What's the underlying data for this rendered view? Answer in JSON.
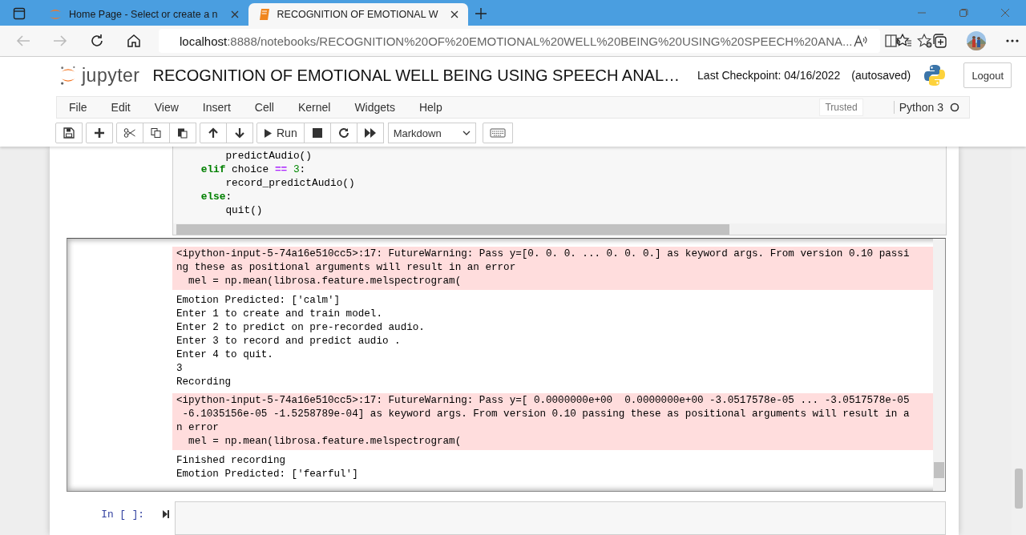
{
  "browser": {
    "tabs": [
      {
        "title": "Home Page - Select or create a n",
        "selected": false,
        "kind": "jupyter"
      },
      {
        "title": "RECOGNITION OF EMOTIONAL W",
        "selected": true,
        "kind": "notebook"
      }
    ],
    "address": {
      "host": "localhost",
      "path": ":8888/notebooks/RECOGNITION%20OF%20EMOTIONAL%20WELL%20BEING%20USING%20SPEECH%20ANA..."
    }
  },
  "notebook_header": {
    "logo": "jupyter",
    "title": "RECOGNITION OF EMOTIONAL WELL BEING USING SPEECH ANAL…",
    "checkpoint": "Last Checkpoint: 04/16/2022",
    "autosave": "(autosaved)",
    "logout": "Logout"
  },
  "menu": [
    "File",
    "Edit",
    "View",
    "Insert",
    "Cell",
    "Kernel",
    "Widgets",
    "Help"
  ],
  "trusted": "Trusted",
  "kernel": "Python 3",
  "toolbar": {
    "run": "Run",
    "cell_type": "Markdown"
  },
  "code_cell": {
    "lines": [
      [
        {
          "text": "        predictAudio()",
          "kind": "plain"
        }
      ],
      [
        {
          "text": "    elif",
          "kind": "keyword"
        },
        {
          "text": " choice ",
          "kind": "plain"
        },
        {
          "text": "==",
          "kind": "operator"
        },
        {
          "text": " 3",
          "kind": "number"
        },
        {
          "text": ":",
          "kind": "plain"
        }
      ],
      [
        {
          "text": "        record_predictAudio()",
          "kind": "plain"
        }
      ],
      [
        {
          "text": "    else",
          "kind": "keyword"
        },
        {
          "text": ":",
          "kind": "plain"
        }
      ],
      [
        {
          "text": "        quit()",
          "kind": "plain"
        }
      ]
    ]
  },
  "output": [
    {
      "kind": "stderr",
      "lines": [
        "<ipython-input-5-74a16e510cc5>:17: FutureWarning: Pass y=[0. 0. 0. ... 0. 0. 0.] as keyword args. From version 0.10 passi",
        "ng these as positional arguments will result in an error",
        "  mel = np.mean(librosa.feature.melspectrogram("
      ]
    },
    {
      "kind": "stdout",
      "lines": [
        "Emotion Predicted: ['calm']",
        "Enter 1 to create and train model.",
        "Enter 2 to predict on pre-recorded audio.",
        "Enter 3 to record and predict audio .",
        "Enter 4 to quit.",
        "3",
        "Recording"
      ]
    },
    {
      "kind": "stderr",
      "lines": [
        "<ipython-input-5-74a16e510cc5>:17: FutureWarning: Pass y=[ 0.0000000e+00  0.0000000e+00 -3.0517578e-05 ... -3.0517578e-05",
        " -6.1035156e-05 -1.5258789e-04] as keyword args. From version 0.10 passing these as positional arguments will result in a",
        "n error",
        "  mel = np.mean(librosa.feature.melspectrogram("
      ]
    },
    {
      "kind": "stdout",
      "lines": [
        "Finished recording",
        "Emotion Predicted: ['fearful']"
      ]
    }
  ],
  "next_cell": {
    "prompt": "In [ ]:"
  }
}
